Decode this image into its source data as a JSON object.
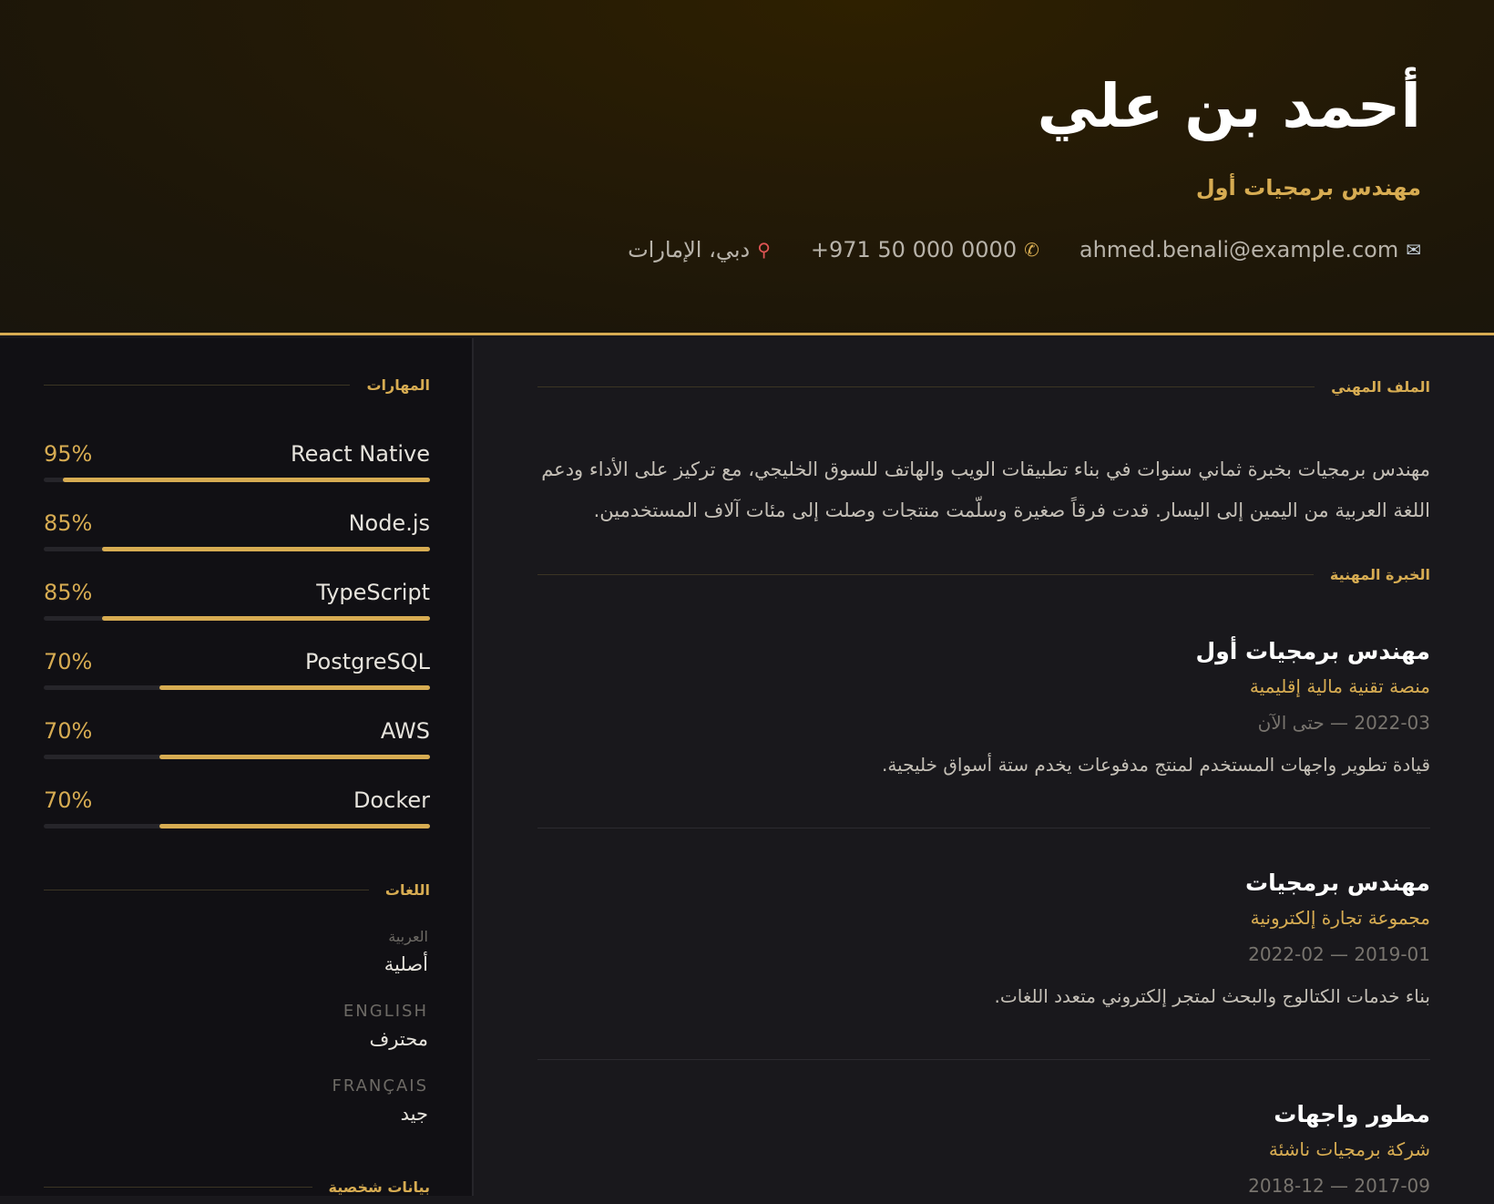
{
  "header": {
    "name": "أحمد بن علي",
    "role": "مهندس برمجيات أول",
    "contacts": {
      "email": {
        "icon": "envelope-icon",
        "value": "ahmed.benali@example.com"
      },
      "phone": {
        "icon": "phone-icon",
        "value": "+971 50 000 0000"
      },
      "location": {
        "icon": "pin-icon",
        "value": "دبي، الإمارات"
      }
    }
  },
  "sidebar": {
    "skills_title": "المهارات",
    "skills": [
      {
        "name": "React Native",
        "percent_label": "95%",
        "level": 0.95
      },
      {
        "name": "Node.js",
        "percent_label": "85%",
        "level": 0.85
      },
      {
        "name": "TypeScript",
        "percent_label": "85%",
        "level": 0.85
      },
      {
        "name": "PostgreSQL",
        "percent_label": "70%",
        "level": 0.7
      },
      {
        "name": "AWS",
        "percent_label": "70%",
        "level": 0.7
      },
      {
        "name": "Docker",
        "percent_label": "70%",
        "level": 0.7
      }
    ],
    "languages_title": "اللغات",
    "languages": [
      {
        "name": "العربية",
        "level": "أصلية"
      },
      {
        "name": "ENGLISH",
        "level": "محترف"
      },
      {
        "name": "FRANÇAIS",
        "level": "جيد"
      }
    ],
    "personal_title": "بيانات شخصية"
  },
  "main": {
    "profile_title": "الملف المهني",
    "profile_text": "مهندس برمجيات بخبرة ثماني سنوات في بناء تطبيقات الويب والهاتف للسوق الخليجي، مع تركيز على الأداء ودعم اللغة العربية من اليمين إلى اليسار. قدت فرقاً صغيرة وسلّمت منتجات وصلت إلى مئات آلاف المستخدمين.",
    "experience_title": "الخبرة المهنية",
    "jobs": [
      {
        "title": "مهندس برمجيات أول",
        "company": "منصة تقنية مالية إقليمية",
        "dates": "2022-03 — حتى الآن",
        "desc": "قيادة تطوير واجهات المستخدم لمنتج مدفوعات يخدم ستة أسواق خليجية."
      },
      {
        "title": "مهندس برمجيات",
        "company": "مجموعة تجارة إلكترونية",
        "dates": "2019-01 — 2022-02",
        "desc": "بناء خدمات الكتالوج والبحث لمتجر إلكتروني متعدد اللغات."
      },
      {
        "title": "مطور واجهات",
        "company": "شركة برمجيات ناشئة",
        "dates": "2017-09 — 2018-12",
        "desc": ""
      }
    ]
  },
  "colors": {
    "accent": "#d7ac52",
    "background": "#19181c",
    "sidebar": "#111014"
  }
}
